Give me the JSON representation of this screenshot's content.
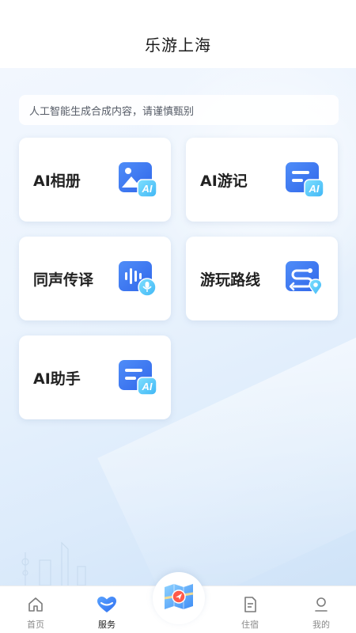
{
  "header": {
    "title": "乐游上海"
  },
  "notice": {
    "text": "人工智能生成合成内容，请谨慎甄别"
  },
  "cards": [
    {
      "label": "AI相册",
      "icon": "ai-photo-album-icon"
    },
    {
      "label": "AI游记",
      "icon": "ai-travel-notes-icon"
    },
    {
      "label": "同声传译",
      "icon": "voice-translation-icon"
    },
    {
      "label": "游玩路线",
      "icon": "route-map-icon"
    },
    {
      "label": "AI助手",
      "icon": "ai-assistant-icon"
    }
  ],
  "tabbar": {
    "items": [
      {
        "label": "首页",
        "icon": "home-icon"
      },
      {
        "label": "服务",
        "icon": "heart-services-icon",
        "active": true
      },
      {
        "label": "住宿",
        "icon": "document-icon"
      },
      {
        "label": "我的",
        "icon": "user-icon"
      }
    ],
    "center_icon": "map-location-icon"
  },
  "colors": {
    "accent": "#3d7cf5",
    "accent_light": "#5ec5f5",
    "background_gradient_start": "#f2f7fe",
    "background_gradient_end": "#cfe3f8"
  }
}
